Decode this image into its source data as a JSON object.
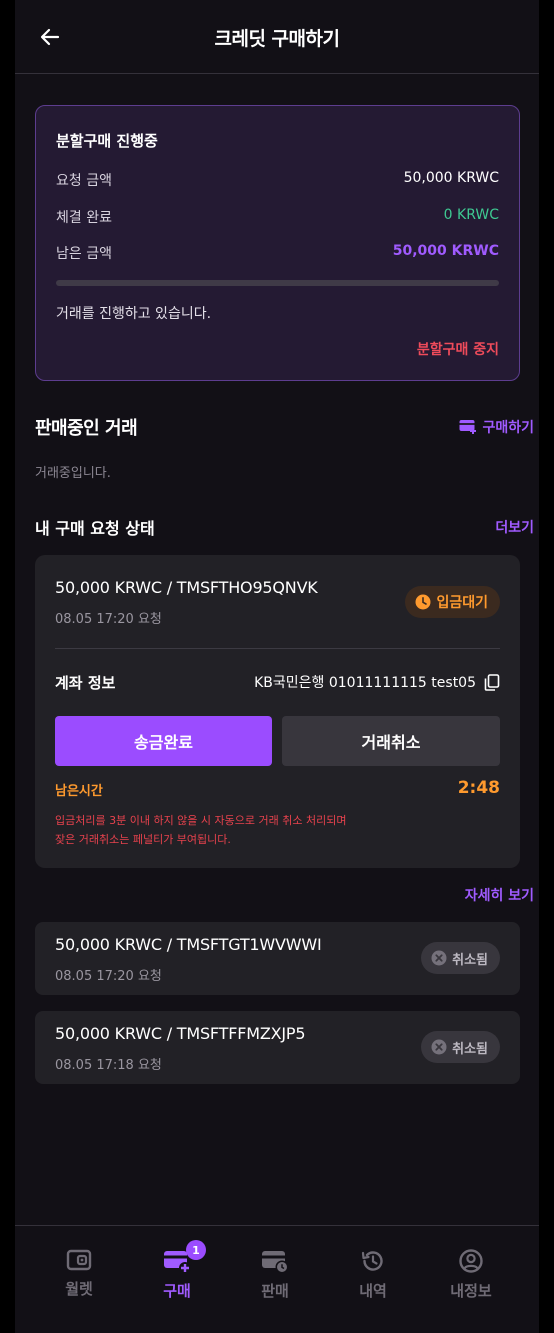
{
  "header": {
    "title": "크레딧 구매하기"
  },
  "split": {
    "title": "분할구매 진행중",
    "rows": [
      {
        "label": "요청 금액",
        "value": "50,000 KRWC",
        "color": "#ffffff"
      },
      {
        "label": "체결 완료",
        "value": "0 KRWC",
        "color": "#3ec992"
      },
      {
        "label": "남은 금액",
        "value": "50,000 KRWC",
        "color": "#a05bff"
      }
    ],
    "progress_fraction": 0,
    "message": "거래를 진행하고 있습니다.",
    "stop_label": "분할구매 중지"
  },
  "selling": {
    "title": "판매중인 거래",
    "buy_label": "구매하기",
    "empty_text": "거래중입니다."
  },
  "requests": {
    "title": "내 구매 요청 상태",
    "more_label": "더보기",
    "active": {
      "title": "50,000 KRWC / TMSFTHO95QNVK",
      "time": "08.05 17:20 요청",
      "status": "입금대기",
      "account_label": "계좌 정보",
      "account_value": "KB국민은행 01011111115 test05",
      "confirm_label": "송금완료",
      "cancel_label": "거래취소",
      "remain_label": "남은시간",
      "remain_time": "2:48",
      "warning_line1": "입금처리를 3분 이내 하지 않을 시 자동으로 거래 취소 처리되며",
      "warning_line2": "잦은 거래취소는 페널티가 부여됩니다."
    },
    "detail_label": "자세히 보기",
    "canceled": [
      {
        "title": "50,000 KRWC / TMSFTGT1WVWWI",
        "time": "08.05 17:20 요청",
        "status": "취소됨"
      },
      {
        "title": "50,000 KRWC / TMSFTFFMZXJP5",
        "time": "08.05 17:18 요청",
        "status": "취소됨"
      }
    ]
  },
  "nav": {
    "items": [
      {
        "label": "월렛",
        "icon": "wallet-icon"
      },
      {
        "label": "구매",
        "icon": "buy-card-icon",
        "badge": "1"
      },
      {
        "label": "판매",
        "icon": "sell-card-icon"
      },
      {
        "label": "내역",
        "icon": "history-icon"
      },
      {
        "label": "내정보",
        "icon": "profile-icon"
      }
    ]
  },
  "colors": {
    "accent": "#9b4cff",
    "warning": "#ff9a2e",
    "danger": "#ef4b5b",
    "success": "#3ec992"
  }
}
